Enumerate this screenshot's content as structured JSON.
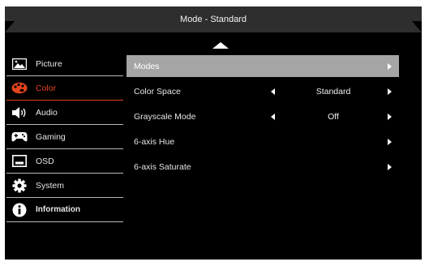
{
  "header": {
    "title": "Mode - Standard"
  },
  "sidebar": {
    "items": [
      {
        "label": "Picture",
        "icon": "picture-icon"
      },
      {
        "label": "Color",
        "icon": "palette-icon"
      },
      {
        "label": "Audio",
        "icon": "speaker-icon"
      },
      {
        "label": "Gaming",
        "icon": "gamepad-icon"
      },
      {
        "label": "OSD",
        "icon": "osd-icon"
      },
      {
        "label": "System",
        "icon": "gear-icon"
      },
      {
        "label": "Information",
        "icon": "info-icon"
      }
    ],
    "active_item": "Color"
  },
  "main": {
    "rows": [
      {
        "label": "Modes",
        "value": ""
      },
      {
        "label": "Color Space",
        "value": "Standard"
      },
      {
        "label": "Grayscale Mode",
        "value": "Off"
      },
      {
        "label": "6-axis Hue",
        "value": ""
      },
      {
        "label": "6-axis Saturate",
        "value": ""
      }
    ],
    "selected_row": "Modes"
  },
  "colors": {
    "accent": "#e3441f",
    "selected_row_bg": "#a5a5a5",
    "title_bg": "#2e2e2e",
    "background": "#000000"
  }
}
